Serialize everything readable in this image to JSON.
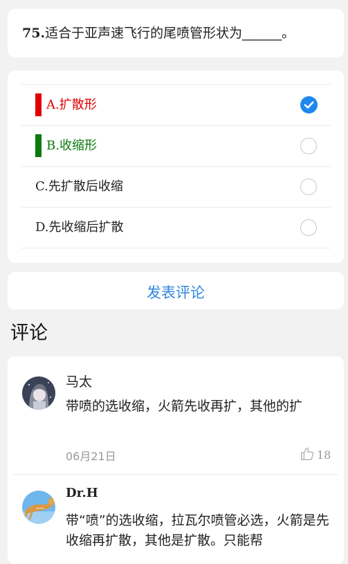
{
  "question": {
    "number": "75.",
    "text": "适合于亚声速飞行的尾喷管形状为______。"
  },
  "options": [
    {
      "letter": "A.",
      "text": "扩散形",
      "selected": true,
      "color": "#e00000",
      "marker": "red-marker"
    },
    {
      "letter": "B.",
      "text": "收缩形",
      "selected": false,
      "color": "#0a7a0a",
      "marker": "green-marker"
    },
    {
      "letter": "C.",
      "text": "先扩散后收缩",
      "selected": false,
      "color": "#222222"
    },
    {
      "letter": "D.",
      "text": "先收缩后扩散",
      "selected": false,
      "color": "#222222"
    }
  ],
  "comment_button": {
    "label": "发表评论"
  },
  "comments_section": {
    "title": "评论"
  },
  "comments": [
    {
      "author": "马太",
      "avatar": "anime-girl-avatar",
      "text": "带喷的选收缩，火箭先收再扩，其他的扩",
      "date": "06月21日",
      "likes": "18"
    },
    {
      "author": "Dr.H",
      "avatar": "cat-avatar",
      "text": "带“喷”的选收缩，拉瓦尔喷管必选，火箭是先收缩再扩散，其他是扩散。只能帮"
    }
  ],
  "colors": {
    "accent": "#1e88f0",
    "link": "#2e86de",
    "correct": "#0a7a0a",
    "wrong": "#e00000"
  }
}
